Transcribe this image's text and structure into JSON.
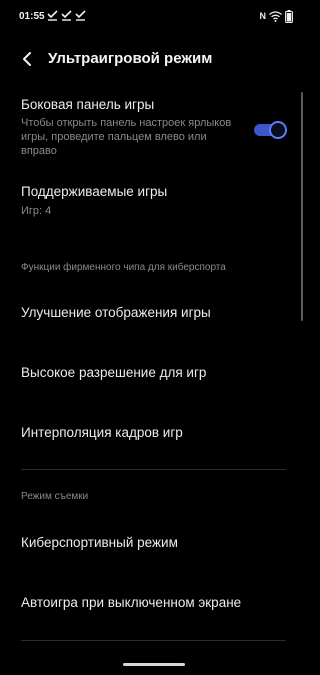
{
  "status_bar": {
    "time": "01:55",
    "notification_icons": [
      "check-icon",
      "check-icon",
      "check-icon"
    ],
    "right_icons": [
      "nfc-icon",
      "wifi-icon",
      "battery-icon"
    ],
    "nfc_glyph": "N"
  },
  "header": {
    "title": "Ультраигровой режим",
    "back_icon": "chevron-left-icon"
  },
  "settings": {
    "game_panel": {
      "title": "Боковая панель игры",
      "description": "Чтобы открыть панель настроек ярлыков игры, проведите пальцем влево или вправо",
      "toggle_on": true
    },
    "supported_games": {
      "title": "Поддерживаемые игры",
      "subtitle": "Игр: 4"
    }
  },
  "sections": {
    "esports_chip": {
      "label": "Функции фирменного чипа для киберспорта",
      "items": [
        "Улучшение отображения игры",
        "Высокое разрешение для игр",
        "Интерполяция кадров игр"
      ]
    },
    "capture": {
      "label": "Режим съемки",
      "items": [
        "Киберспортивный режим",
        "Автоигра при выключенном экране"
      ]
    }
  },
  "colors": {
    "background": "#000000",
    "accent": "#5d7bff",
    "toggle_track": "#3d56c8",
    "primary_text": "#ececec",
    "secondary_text": "#8a8a8a"
  }
}
